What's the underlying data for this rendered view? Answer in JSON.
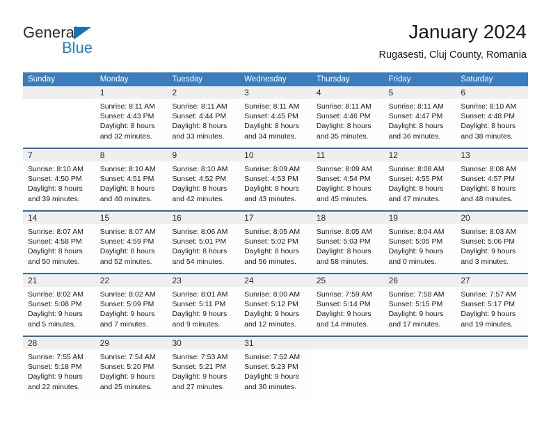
{
  "brand": {
    "name_part1": "General",
    "name_part2": "Blue",
    "triangle_color": "#1a6fb5",
    "blue_text_color": "#1e7fc4"
  },
  "header": {
    "title": "January 2024",
    "subtitle": "Rugasesti, Cluj County, Romania"
  },
  "theme": {
    "header_row_bg": "#3a7cbe",
    "week_divider": "#2e6da4",
    "date_band_bg": "#efefef",
    "cell_bg": "#fdfdfd"
  },
  "calendar": {
    "day_headers": [
      "Sunday",
      "Monday",
      "Tuesday",
      "Wednesday",
      "Thursday",
      "Friday",
      "Saturday"
    ],
    "weeks": [
      {
        "days": [
          {
            "date": "",
            "lines": []
          },
          {
            "date": "1",
            "lines": [
              "Sunrise: 8:11 AM",
              "Sunset: 4:43 PM",
              "Daylight: 8 hours",
              "and 32 minutes."
            ]
          },
          {
            "date": "2",
            "lines": [
              "Sunrise: 8:11 AM",
              "Sunset: 4:44 PM",
              "Daylight: 8 hours",
              "and 33 minutes."
            ]
          },
          {
            "date": "3",
            "lines": [
              "Sunrise: 8:11 AM",
              "Sunset: 4:45 PM",
              "Daylight: 8 hours",
              "and 34 minutes."
            ]
          },
          {
            "date": "4",
            "lines": [
              "Sunrise: 8:11 AM",
              "Sunset: 4:46 PM",
              "Daylight: 8 hours",
              "and 35 minutes."
            ]
          },
          {
            "date": "5",
            "lines": [
              "Sunrise: 8:11 AM",
              "Sunset: 4:47 PM",
              "Daylight: 8 hours",
              "and 36 minutes."
            ]
          },
          {
            "date": "6",
            "lines": [
              "Sunrise: 8:10 AM",
              "Sunset: 4:48 PM",
              "Daylight: 8 hours",
              "and 38 minutes."
            ]
          }
        ]
      },
      {
        "days": [
          {
            "date": "7",
            "lines": [
              "Sunrise: 8:10 AM",
              "Sunset: 4:50 PM",
              "Daylight: 8 hours",
              "and 39 minutes."
            ]
          },
          {
            "date": "8",
            "lines": [
              "Sunrise: 8:10 AM",
              "Sunset: 4:51 PM",
              "Daylight: 8 hours",
              "and 40 minutes."
            ]
          },
          {
            "date": "9",
            "lines": [
              "Sunrise: 8:10 AM",
              "Sunset: 4:52 PM",
              "Daylight: 8 hours",
              "and 42 minutes."
            ]
          },
          {
            "date": "10",
            "lines": [
              "Sunrise: 8:09 AM",
              "Sunset: 4:53 PM",
              "Daylight: 8 hours",
              "and 43 minutes."
            ]
          },
          {
            "date": "11",
            "lines": [
              "Sunrise: 8:09 AM",
              "Sunset: 4:54 PM",
              "Daylight: 8 hours",
              "and 45 minutes."
            ]
          },
          {
            "date": "12",
            "lines": [
              "Sunrise: 8:08 AM",
              "Sunset: 4:55 PM",
              "Daylight: 8 hours",
              "and 47 minutes."
            ]
          },
          {
            "date": "13",
            "lines": [
              "Sunrise: 8:08 AM",
              "Sunset: 4:57 PM",
              "Daylight: 8 hours",
              "and 48 minutes."
            ]
          }
        ]
      },
      {
        "days": [
          {
            "date": "14",
            "lines": [
              "Sunrise: 8:07 AM",
              "Sunset: 4:58 PM",
              "Daylight: 8 hours",
              "and 50 minutes."
            ]
          },
          {
            "date": "15",
            "lines": [
              "Sunrise: 8:07 AM",
              "Sunset: 4:59 PM",
              "Daylight: 8 hours",
              "and 52 minutes."
            ]
          },
          {
            "date": "16",
            "lines": [
              "Sunrise: 8:06 AM",
              "Sunset: 5:01 PM",
              "Daylight: 8 hours",
              "and 54 minutes."
            ]
          },
          {
            "date": "17",
            "lines": [
              "Sunrise: 8:05 AM",
              "Sunset: 5:02 PM",
              "Daylight: 8 hours",
              "and 56 minutes."
            ]
          },
          {
            "date": "18",
            "lines": [
              "Sunrise: 8:05 AM",
              "Sunset: 5:03 PM",
              "Daylight: 8 hours",
              "and 58 minutes."
            ]
          },
          {
            "date": "19",
            "lines": [
              "Sunrise: 8:04 AM",
              "Sunset: 5:05 PM",
              "Daylight: 9 hours",
              "and 0 minutes."
            ]
          },
          {
            "date": "20",
            "lines": [
              "Sunrise: 8:03 AM",
              "Sunset: 5:06 PM",
              "Daylight: 9 hours",
              "and 3 minutes."
            ]
          }
        ]
      },
      {
        "days": [
          {
            "date": "21",
            "lines": [
              "Sunrise: 8:02 AM",
              "Sunset: 5:08 PM",
              "Daylight: 9 hours",
              "and 5 minutes."
            ]
          },
          {
            "date": "22",
            "lines": [
              "Sunrise: 8:02 AM",
              "Sunset: 5:09 PM",
              "Daylight: 9 hours",
              "and 7 minutes."
            ]
          },
          {
            "date": "23",
            "lines": [
              "Sunrise: 8:01 AM",
              "Sunset: 5:11 PM",
              "Daylight: 9 hours",
              "and 9 minutes."
            ]
          },
          {
            "date": "24",
            "lines": [
              "Sunrise: 8:00 AM",
              "Sunset: 5:12 PM",
              "Daylight: 9 hours",
              "and 12 minutes."
            ]
          },
          {
            "date": "25",
            "lines": [
              "Sunrise: 7:59 AM",
              "Sunset: 5:14 PM",
              "Daylight: 9 hours",
              "and 14 minutes."
            ]
          },
          {
            "date": "26",
            "lines": [
              "Sunrise: 7:58 AM",
              "Sunset: 5:15 PM",
              "Daylight: 9 hours",
              "and 17 minutes."
            ]
          },
          {
            "date": "27",
            "lines": [
              "Sunrise: 7:57 AM",
              "Sunset: 5:17 PM",
              "Daylight: 9 hours",
              "and 19 minutes."
            ]
          }
        ]
      },
      {
        "days": [
          {
            "date": "28",
            "lines": [
              "Sunrise: 7:55 AM",
              "Sunset: 5:18 PM",
              "Daylight: 9 hours",
              "and 22 minutes."
            ]
          },
          {
            "date": "29",
            "lines": [
              "Sunrise: 7:54 AM",
              "Sunset: 5:20 PM",
              "Daylight: 9 hours",
              "and 25 minutes."
            ]
          },
          {
            "date": "30",
            "lines": [
              "Sunrise: 7:53 AM",
              "Sunset: 5:21 PM",
              "Daylight: 9 hours",
              "and 27 minutes."
            ]
          },
          {
            "date": "31",
            "lines": [
              "Sunrise: 7:52 AM",
              "Sunset: 5:23 PM",
              "Daylight: 9 hours",
              "and 30 minutes."
            ]
          },
          {
            "date": "",
            "lines": []
          },
          {
            "date": "",
            "lines": []
          },
          {
            "date": "",
            "lines": []
          }
        ]
      }
    ]
  }
}
